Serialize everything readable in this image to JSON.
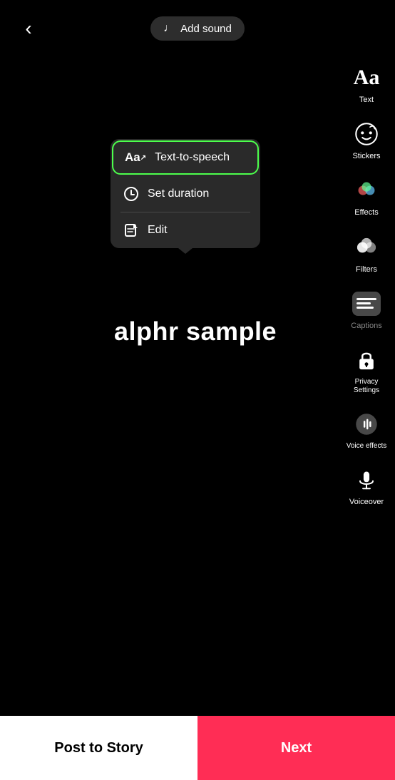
{
  "header": {
    "back_label": "‹",
    "add_sound_label": "Add sound"
  },
  "toolbar": {
    "items": [
      {
        "id": "text",
        "label": "Text",
        "icon": "text"
      },
      {
        "id": "stickers",
        "label": "Stickers",
        "icon": "stickers"
      },
      {
        "id": "effects",
        "label": "Effects",
        "icon": "effects"
      },
      {
        "id": "filters",
        "label": "Filters",
        "icon": "filters"
      },
      {
        "id": "captions",
        "label": "Captions",
        "icon": "captions",
        "dim": true
      },
      {
        "id": "privacy",
        "label": "Privacy Settings",
        "icon": "privacy"
      },
      {
        "id": "voice",
        "label": "Voice effects",
        "icon": "voice"
      },
      {
        "id": "voiceover",
        "label": "Voiceover",
        "icon": "voiceover"
      }
    ]
  },
  "context_menu": {
    "items": [
      {
        "id": "text-to-speech",
        "label": "Text-to-speech",
        "icon": "Aa",
        "highlighted": true
      },
      {
        "id": "set-duration",
        "label": "Set duration",
        "icon": "clock"
      },
      {
        "id": "edit",
        "label": "Edit",
        "icon": "edit"
      }
    ]
  },
  "text_overlay": {
    "content": "alphr sample"
  },
  "bottom_bar": {
    "post_story_label": "Post to Story",
    "next_label": "Next"
  }
}
